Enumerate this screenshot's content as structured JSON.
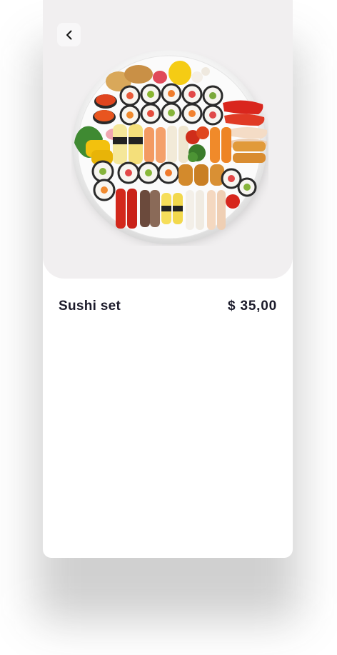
{
  "product": {
    "name": "Sushi set",
    "price": "$ 35,00",
    "image_alt": "Sushi platter"
  },
  "header": {
    "back_icon": "chevron-left-icon"
  },
  "colors": {
    "hero_background": "#f1eff0",
    "text": "#1b1a2a",
    "card": "#ffffff"
  }
}
